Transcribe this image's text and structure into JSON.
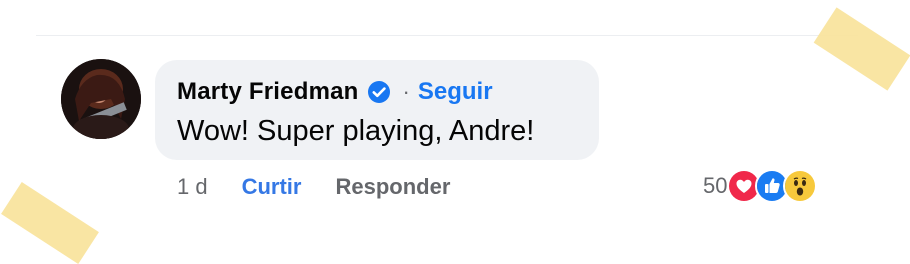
{
  "comment": {
    "author": "Marty Friedman",
    "verified_icon": "verified-badge-icon",
    "separator": "·",
    "follow_label": "Seguir",
    "text": "Wow! Super playing, Andre!"
  },
  "actions": {
    "time": "1 d",
    "like_label": "Curtir",
    "reply_label": "Responder"
  },
  "reactions": {
    "count": "50",
    "icons": [
      "love-reaction-icon",
      "like-reaction-icon",
      "wow-reaction-icon"
    ]
  },
  "colors": {
    "link_blue": "#1877f2",
    "bubble_bg": "#f0f2f5",
    "secondary_text": "#65676b",
    "tape": "#f9e39b"
  }
}
